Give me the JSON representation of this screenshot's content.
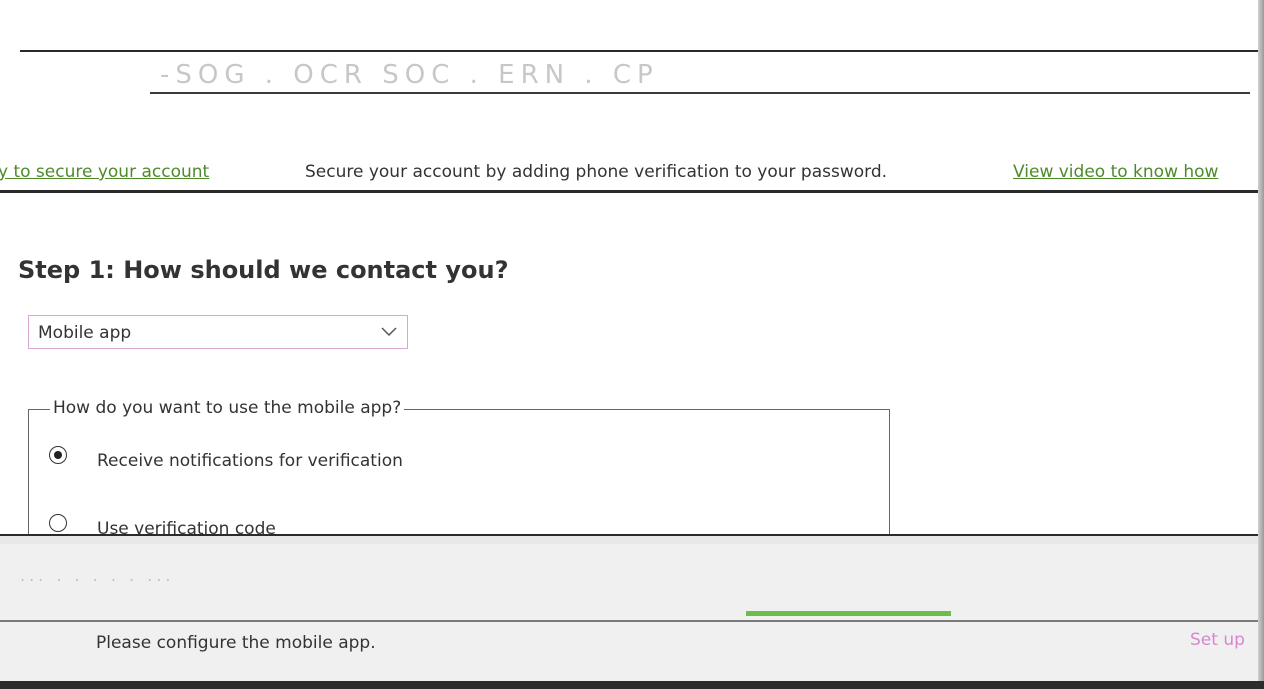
{
  "header": {
    "garbled": "-SOG . OCR SOC . ERN . CP"
  },
  "banner": {
    "left_link": "y to secure your account",
    "message": "Secure your account by adding phone verification to your password.",
    "right_link": "View video to know how"
  },
  "step1": {
    "heading": "Step 1: How should we contact you?",
    "contact_method": {
      "selected": "Mobile app"
    },
    "mobile_app_group": {
      "legend": "How do you want to use the mobile app?",
      "options": [
        {
          "label": "Receive notifications for verification",
          "checked": true
        },
        {
          "label": "Use verification code",
          "checked": false
        }
      ]
    }
  },
  "footer": {
    "garbled": "... . . . . . ...",
    "status": "Please configure the mobile app.",
    "setup_link": "Set up"
  },
  "colors": {
    "link_green": "#4e8a2a",
    "progress_green": "#6abf4b",
    "setup_pink": "#d986d0"
  }
}
